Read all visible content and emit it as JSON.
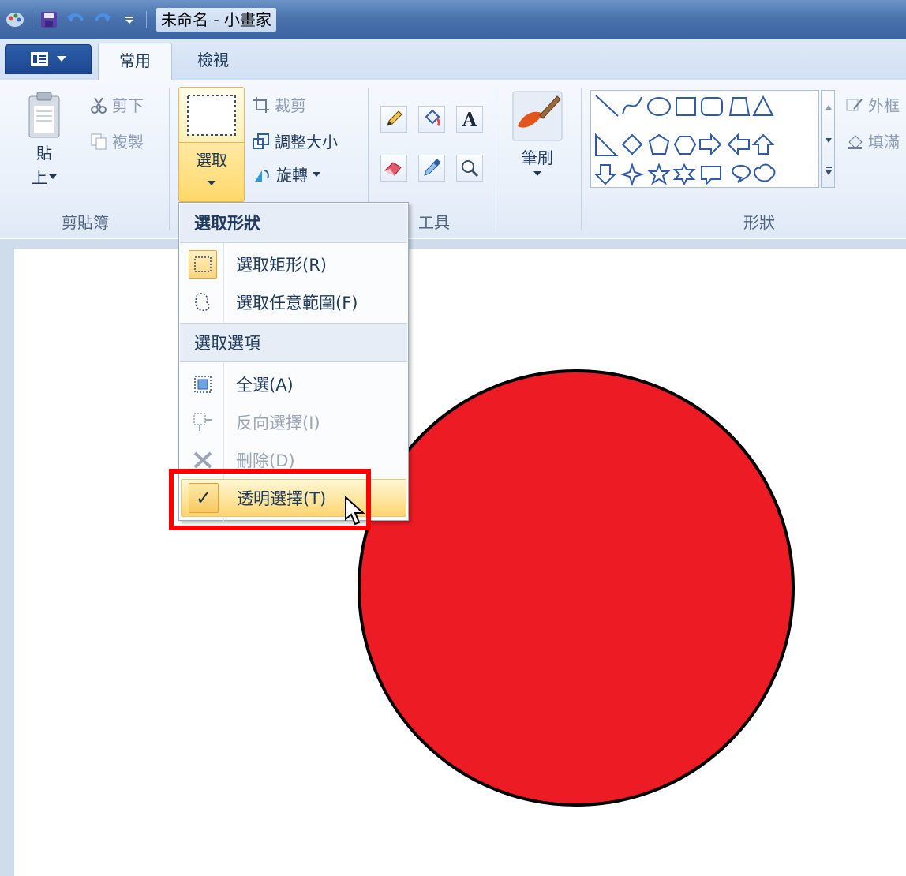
{
  "window": {
    "title": "未命名 - 小畫家"
  },
  "tabs": [
    {
      "label": "常用"
    },
    {
      "label": "檢視"
    }
  ],
  "clipboard": {
    "paste": "貼",
    "paste_sub": "上",
    "cut": "剪下",
    "copy": "複製",
    "group": "剪貼簿"
  },
  "image": {
    "select": "選取",
    "crop": "裁剪",
    "resize": "調整大小",
    "rotate": "旋轉"
  },
  "tools": {
    "group": "工具"
  },
  "brushes": {
    "label": "筆刷"
  },
  "shapes": {
    "group": "形狀",
    "outline": "外框",
    "fill": "填滿"
  },
  "menu": {
    "header_shapes": "選取形狀",
    "rect": "選取矩形(R)",
    "free": "選取任意範圍(F)",
    "header_options": "選取選項",
    "all": "全選(A)",
    "invert": "反向選擇(I)",
    "delete": "刪除(D)",
    "transparent": "透明選擇(T)"
  },
  "colors": {
    "circle_fill": "#ed1c24",
    "highlight": "#ff0000",
    "ribbon_bg": "#f5f9fe"
  }
}
